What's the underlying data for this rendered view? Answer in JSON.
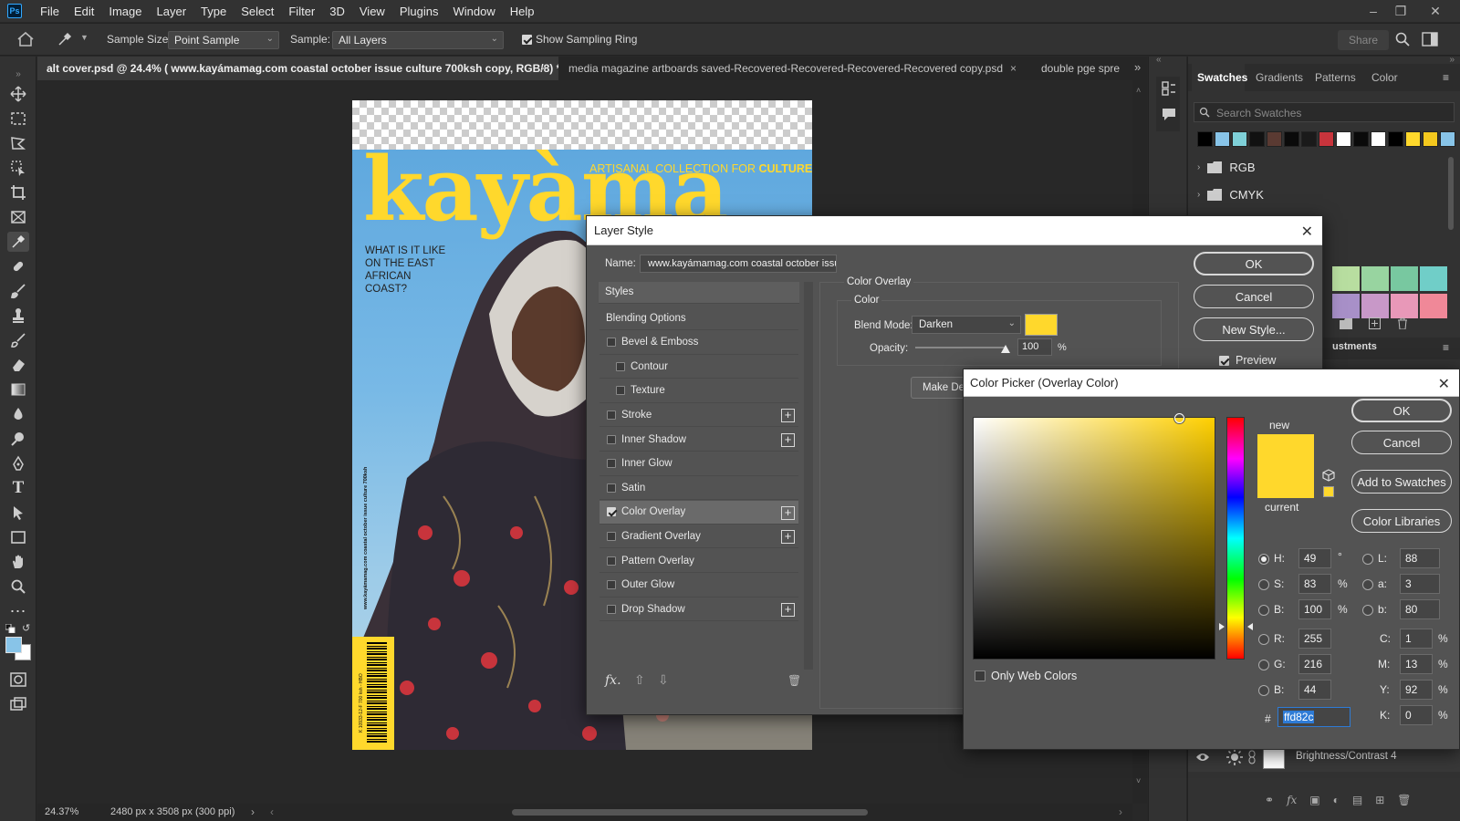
{
  "menubar": {
    "logo": "Ps",
    "items": [
      "File",
      "Edit",
      "Image",
      "Layer",
      "Type",
      "Select",
      "Filter",
      "3D",
      "View",
      "Plugins",
      "Window",
      "Help"
    ]
  },
  "options": {
    "sample_size_label": "Sample Size:",
    "sample_size_value": "Point Sample",
    "sample_label": "Sample:",
    "sample_value": "All Layers",
    "show_ring_label": "Show Sampling Ring",
    "share_label": "Share"
  },
  "tabs": [
    {
      "label": "alt cover.psd @ 24.4% ( www.kayámamag.com coastal october issue culture 700ksh copy, RGB/8) *"
    },
    {
      "label": "media magazine artboards saved-Recovered-Recovered-Recovered-Recovered copy.psd"
    },
    {
      "label": "double pge spre"
    }
  ],
  "document": {
    "masthead": "kayàma",
    "tagline_prefix": "ARTISANAL COLLECTION FOR ",
    "tagline_emphasis": "CULTURE",
    "cover_question": "WHAT IS IT LIKE ON THE EAST AFRICAN COAST?",
    "spine_text": "www.kayámamag.com coastal october issue culture 700ksh",
    "barcode_number": "K 10933-12-F 700 ksh - HBO"
  },
  "status": {
    "zoom": "24.37%",
    "doc_size": "2480 px x 3508 px (300 ppi)"
  },
  "panel": {
    "tabs": [
      "Swatches",
      "Gradients",
      "Patterns",
      "Color"
    ],
    "search_placeholder": "Search Swatches",
    "swatch_colors": [
      "#000000",
      "#88c4e8",
      "#7fd0d8",
      "#111111",
      "#5a3a32",
      "#0a0a0a",
      "#1a1a1a",
      "#c8343c",
      "#ffffff",
      "#0a0a0a",
      "#ffffff",
      "#000000",
      "#ffd82c",
      "#f4c81e",
      "#88c4e8"
    ],
    "groups": [
      "RGB",
      "CMYK"
    ],
    "color_grid_row1": [
      "#b8dea0",
      "#98d4a0",
      "#78c8a0",
      "#70cec8"
    ],
    "color_grid_row2": [
      "#a890c8",
      "#c898c8",
      "#e898b8",
      "#f08898"
    ],
    "adjustments_label": "ustments",
    "layer_name": "Brightness/Contrast 4"
  },
  "layer_style": {
    "title": "Layer Style",
    "name_label": "Name:",
    "name_value": "www.kayámamag.com coastal october issue",
    "styles_header": "Styles",
    "items": [
      {
        "label": "Blending Options",
        "check": false,
        "plus": false,
        "indent": false,
        "header": true
      },
      {
        "label": "Bevel & Emboss",
        "check": true,
        "checked": false,
        "plus": false,
        "indent": false
      },
      {
        "label": "Contour",
        "check": true,
        "checked": false,
        "plus": false,
        "indent": true
      },
      {
        "label": "Texture",
        "check": true,
        "checked": false,
        "plus": false,
        "indent": true
      },
      {
        "label": "Stroke",
        "check": true,
        "checked": false,
        "plus": true,
        "indent": false
      },
      {
        "label": "Inner Shadow",
        "check": true,
        "checked": false,
        "plus": true,
        "indent": false
      },
      {
        "label": "Inner Glow",
        "check": true,
        "checked": false,
        "plus": false,
        "indent": false
      },
      {
        "label": "Satin",
        "check": true,
        "checked": false,
        "plus": false,
        "indent": false
      },
      {
        "label": "Color Overlay",
        "check": true,
        "checked": true,
        "plus": true,
        "indent": false,
        "selected": true
      },
      {
        "label": "Gradient Overlay",
        "check": true,
        "checked": false,
        "plus": true,
        "indent": false
      },
      {
        "label": "Pattern Overlay",
        "check": true,
        "checked": false,
        "plus": false,
        "indent": false
      },
      {
        "label": "Outer Glow",
        "check": true,
        "checked": false,
        "plus": false,
        "indent": false
      },
      {
        "label": "Drop Shadow",
        "check": true,
        "checked": false,
        "plus": true,
        "indent": false
      }
    ],
    "section_title": "Color Overlay",
    "subsection_title": "Color",
    "blend_mode_label": "Blend Mode:",
    "blend_mode_value": "Darken",
    "overlay_color": "#ffd82c",
    "opacity_label": "Opacity:",
    "opacity_value": "100",
    "opacity_unit": "%",
    "make_default_label": "Make Def",
    "ok_label": "OK",
    "cancel_label": "Cancel",
    "new_style_label": "New Style...",
    "preview_label": "Preview",
    "fx_label": "fx."
  },
  "color_picker": {
    "title": "Color Picker (Overlay Color)",
    "new_label": "new",
    "current_label": "current",
    "new_color": "#ffd82c",
    "current_color": "#ffd82c",
    "ok_label": "OK",
    "cancel_label": "Cancel",
    "add_swatches_label": "Add to Swatches",
    "libraries_label": "Color Libraries",
    "only_web_label": "Only Web Colors",
    "fields": {
      "H": "49",
      "S": "83",
      "Bv": "100",
      "R": "255",
      "G": "216",
      "Bc": "44",
      "L": "88",
      "a": "3",
      "b": "80",
      "C": "1",
      "M": "13",
      "Y": "92",
      "K": "0"
    },
    "labels": {
      "H": "H:",
      "S": "S:",
      "Bv": "B:",
      "R": "R:",
      "G": "G:",
      "Bc": "B:",
      "L": "L:",
      "a": "a:",
      "b": "b:",
      "C": "C:",
      "M": "M:",
      "Y": "Y:",
      "K": "K:"
    },
    "units": {
      "deg": "°",
      "pct": "%"
    },
    "hex_prefix": "#",
    "hex_value": "ffd82c",
    "hue_degrees": 49
  }
}
